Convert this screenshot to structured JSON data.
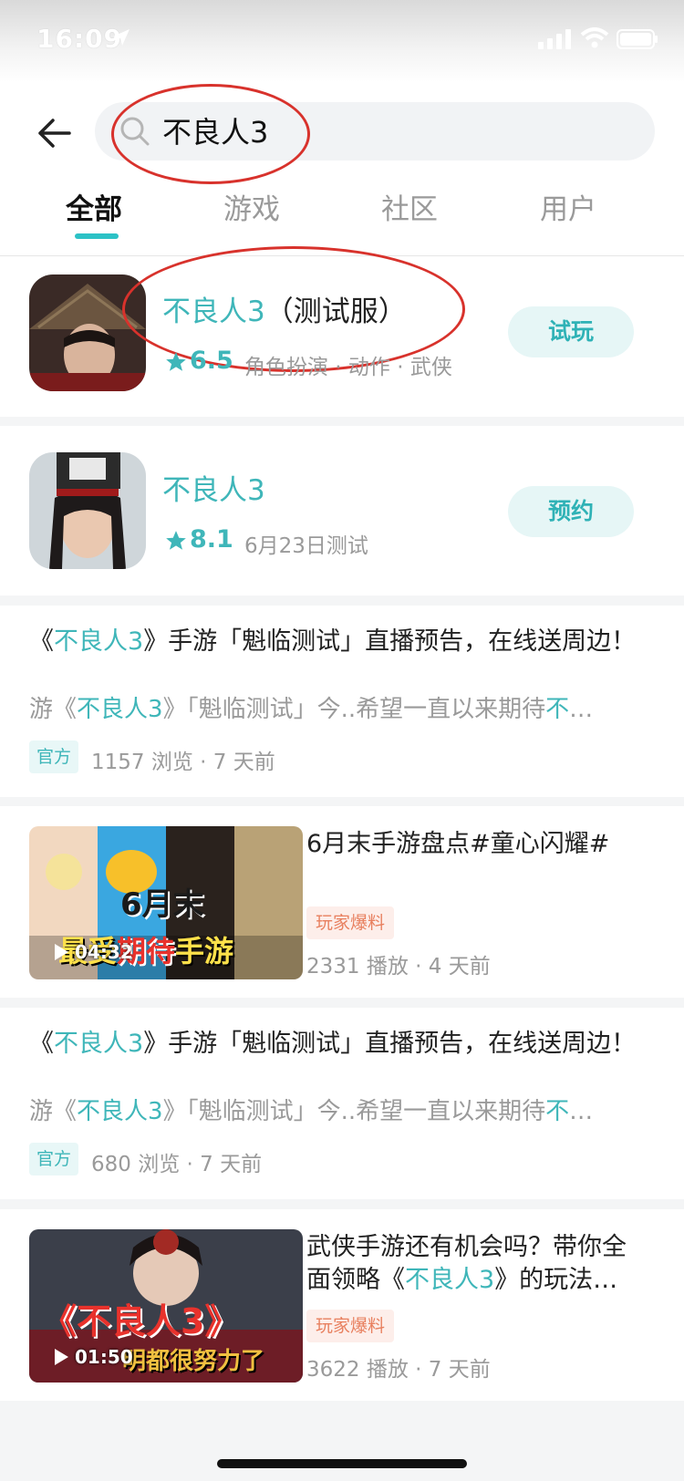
{
  "status": {
    "time": "16:09"
  },
  "search": {
    "query": "不良人3"
  },
  "tabs": [
    "全部",
    "游戏",
    "社区",
    "用户"
  ],
  "games": [
    {
      "name": "不良人3",
      "suffix": "（测试服）",
      "score": "6.5",
      "meta": "角色扮演 · 动作 · 武侠",
      "action": "试玩"
    },
    {
      "name": "不良人3",
      "suffix": "",
      "score": "8.1",
      "meta": "6月23日测试",
      "action": "预约"
    }
  ],
  "post1": {
    "title_pre": "《",
    "title_hl": "不良人3",
    "title_post": "》手游「魁临测试」直播预告，在线送周边！",
    "desc_pre": "游《",
    "desc_hl": "不良人3",
    "desc_mid": "》「魁临测试」今..希望一直以来期待",
    "desc_hl2": "不",
    "desc_post": "…",
    "badge": "官方",
    "views": "1157 浏览 · 7 天前"
  },
  "video1": {
    "title": "6月末手游盘点#童心闪耀#",
    "badge": "玩家爆料",
    "plays": "2331 播放 · 4 天前",
    "duration": "04:32",
    "thumb_text_1": "6月末",
    "thumb_text_2a": "最受",
    "thumb_text_2b": "期待",
    "thumb_text_2c": "手游"
  },
  "post2": {
    "title_pre": "《",
    "title_hl": "不良人3",
    "title_post": "》手游「魁临测试」直播预告，在线送周边！",
    "desc_pre": "游《",
    "desc_hl": "不良人3",
    "desc_mid": "》「魁临测试」今..希望一直以来期待",
    "desc_hl2": "不",
    "desc_post": "…",
    "badge": "官方",
    "views": "680 浏览 · 7 天前"
  },
  "video2": {
    "title_pre": "武侠手游还有机会吗？带你全面领略《",
    "title_hl": "不良人3",
    "title_post": "》的玩法…",
    "badge": "玩家爆料",
    "plays": "3622 播放 · 7 天前",
    "duration": "01:50",
    "thumb_title": "《不良人3》",
    "thumb_caption": "明都很努力了"
  },
  "colors": {
    "accent": "#3fb6b9",
    "annotation": "#d8322c",
    "player_badge": "#e8805f"
  }
}
